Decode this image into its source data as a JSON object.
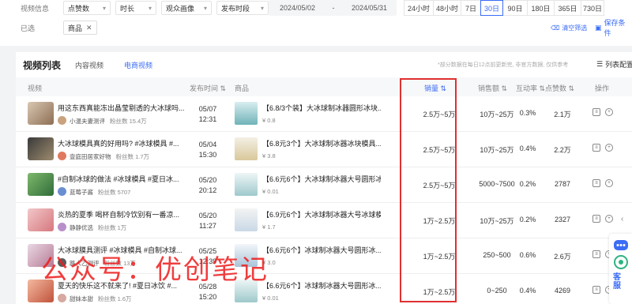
{
  "filters": {
    "label": "视频信息",
    "dropdowns": [
      "点赞数",
      "时长",
      "观众画像",
      "发布时段"
    ],
    "date_start": "2024/05/02",
    "date_sep": "-",
    "date_end": "2024/05/31",
    "ranges": [
      "24小时",
      "48小时",
      "7日",
      "30日",
      "90日",
      "180日",
      "365日",
      "730日"
    ],
    "active_range": "30日",
    "selected_label": "已选",
    "selected_tag": "商品",
    "clear_label": "清空筛选",
    "save_label": "保存条件"
  },
  "panel": {
    "title": "视频列表",
    "tabs": [
      "内容视频",
      "电商视频"
    ],
    "active_tab": "电商视频",
    "note": "*部分数据在每日12点前更新完, 非官方数据, 仅供参考",
    "column_config": "列表配置"
  },
  "columns": {
    "video": "视频",
    "publish_time": "发布时间",
    "product": "商品",
    "sales": "销量",
    "sales_amount": "销售额",
    "interaction": "互动率",
    "likes": "点赞数",
    "ops": "操作"
  },
  "rows": [
    {
      "title": "用这东西真能冻出晶莹剔透的大冰球吗...",
      "author": "小温夫妻测评",
      "fans": "粉丝数 15.4万",
      "date": "05/07",
      "time": "12:31",
      "product": "【6.8/3个装】大冰球制冰器圆形冰块...",
      "price": "¥ 0.8",
      "sales": "2.5万~5万",
      "amount": "10万~25万",
      "rate": "0.3%",
      "likes": "2.1万"
    },
    {
      "title": "大冰球模具真的好用吗? #冰球模具 #...",
      "author": "壹庭田居家好物",
      "fans": "粉丝数 1.7万",
      "date": "05/04",
      "time": "15:30",
      "product": "【6.8元3个】大冰球制冰器冰块模具...",
      "price": "¥ 3.8",
      "sales": "2.5万~5万",
      "amount": "10万~25万",
      "rate": "0.4%",
      "likes": "2.2万"
    },
    {
      "title": "#自制冰球的做法 #冰球模具 #夏日冰...",
      "author": "蓝莓子酱",
      "fans": "粉丝数 5707",
      "date": "05/20",
      "time": "20:12",
      "product": "【6.6元6个】大冰球制冰器大号圆形冰...",
      "price": "¥ 0.01",
      "sales": "2.5万~5万",
      "amount": "5000~7500",
      "rate": "0.2%",
      "likes": "2787"
    },
    {
      "title": "炎热的夏季 喝杯自制冷饮别有一番凉...",
      "author": "静静优选",
      "fans": "粉丝数 1万",
      "date": "05/20",
      "time": "11:27",
      "product": "【6.9元6个】大冰球制冰器大号冰球模...",
      "price": "¥ 1.7",
      "sales": "1万~2.5万",
      "amount": "10万~25万",
      "rate": "0.2%",
      "likes": "2327"
    },
    {
      "title": "大冰球膜具测评 #冰球模具 #自制冰球...",
      "author": "路人乙测评",
      "fans": "粉丝数 13万",
      "date": "05/25",
      "time": "12:39",
      "product": "【6.6元6个】冰球制冰器大号圆形冰...",
      "price": "¥ 3.0",
      "sales": "1万~2.5万",
      "amount": "250~500",
      "rate": "0.6%",
      "likes": "2.6万"
    },
    {
      "title": "夏天的快乐这不就来了! #夏日冰饮 #...",
      "author": "甜妹本甜",
      "fans": "粉丝数 1.6万",
      "date": "05/28",
      "time": "15:20",
      "product": "【6.6元6个】冰球制冰器大号圆形冰...",
      "price": "¥ 0.01",
      "sales": "1万~2.5万",
      "amount": "0~250",
      "rate": "0.4%",
      "likes": "4269"
    }
  ],
  "watermark": "公众号：优创笔记",
  "service_label": "客服",
  "colors": {
    "accent": "#3b6cf6",
    "highlight": "#e03030",
    "watermark": "#ee1c1c"
  }
}
